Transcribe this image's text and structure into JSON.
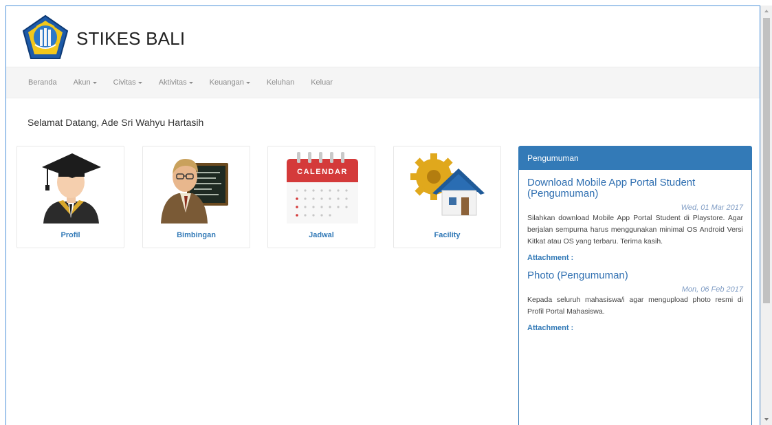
{
  "header": {
    "brand": "STIKES BALI"
  },
  "nav": {
    "items": [
      {
        "label": "Beranda",
        "dropdown": false
      },
      {
        "label": "Akun",
        "dropdown": true
      },
      {
        "label": "Civitas",
        "dropdown": true
      },
      {
        "label": "Aktivitas",
        "dropdown": true
      },
      {
        "label": "Keuangan",
        "dropdown": true
      },
      {
        "label": "Keluhan",
        "dropdown": false
      },
      {
        "label": "Keluar",
        "dropdown": false
      }
    ]
  },
  "welcome": "Selamat Datang, Ade Sri Wahyu Hartasih",
  "tiles": [
    {
      "label": "Profil",
      "icon": "graduate-icon"
    },
    {
      "label": "Bimbingan",
      "icon": "teacher-icon"
    },
    {
      "label": "Jadwal",
      "icon": "calendar-icon",
      "icon_text": "CALENDAR"
    },
    {
      "label": "Facility",
      "icon": "house-gear-icon"
    }
  ],
  "panel": {
    "heading": "Pengumuman",
    "announcements": [
      {
        "title": "Download Mobile App Portal Student (Pengumuman)",
        "date": "Wed, 01 Mar 2017",
        "body": "Silahkan download Mobile App Portal Student di Playstore. Agar berjalan sempurna harus menggunakan minimal OS Android Versi Kitkat atau OS yang terbaru. Terima kasih.",
        "attachment_label": "Attachment :"
      },
      {
        "title": "Photo (Pengumuman)",
        "date": "Mon, 06 Feb 2017",
        "body": "Kepada seluruh mahasiswa/i agar mengupload photo resmi di Profil Portal Mahasiswa.",
        "attachment_label": "Attachment :"
      }
    ]
  },
  "colors": {
    "primary": "#337ab7",
    "navbar_bg": "#f5f5f5",
    "frame_border": "#4a90d9"
  }
}
